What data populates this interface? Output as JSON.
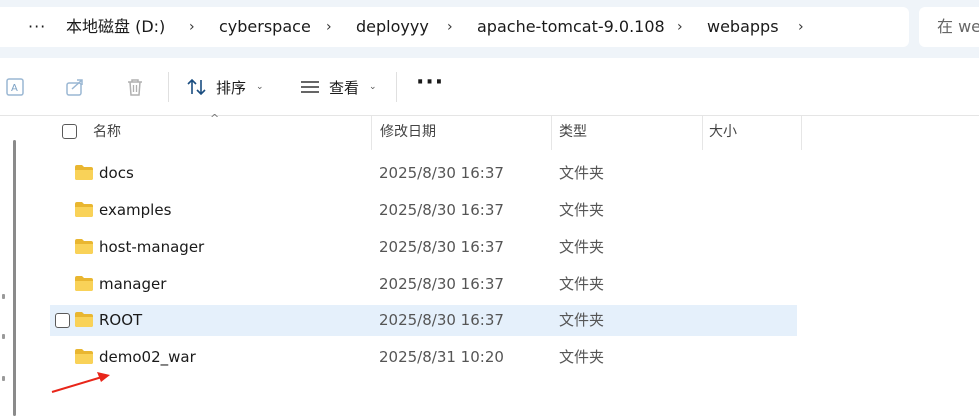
{
  "address_bar": {
    "more": "···",
    "crumbs": [
      "本地磁盘 (D:)",
      "cyberspace",
      "deployyy",
      "apache-tomcat-9.0.108",
      "webapps"
    ],
    "separator": "›"
  },
  "search": {
    "placeholder": "在 we"
  },
  "toolbar": {
    "sort_label": "排序",
    "view_label": "查看",
    "more_label": "···",
    "icons": [
      "rename-icon",
      "share-icon",
      "delete-icon",
      "sort-icon",
      "view-icon"
    ]
  },
  "columns": {
    "name": "名称",
    "date": "修改日期",
    "type": "类型",
    "size": "大小"
  },
  "files": [
    {
      "name": "docs",
      "date": "2025/8/30 16:37",
      "type": "文件夹",
      "size": ""
    },
    {
      "name": "examples",
      "date": "2025/8/30 16:37",
      "type": "文件夹",
      "size": ""
    },
    {
      "name": "host-manager",
      "date": "2025/8/30 16:37",
      "type": "文件夹",
      "size": ""
    },
    {
      "name": "manager",
      "date": "2025/8/30 16:37",
      "type": "文件夹",
      "size": ""
    },
    {
      "name": "ROOT",
      "date": "2025/8/30 16:37",
      "type": "文件夹",
      "size": ""
    },
    {
      "name": "demo02_war",
      "date": "2025/8/31 10:20",
      "type": "文件夹",
      "size": ""
    }
  ],
  "colors": {
    "accent": "#0067c0",
    "selected_row": "#e5f0fb",
    "folder": "#f4c542",
    "annotation_arrow": "#e8261a"
  }
}
